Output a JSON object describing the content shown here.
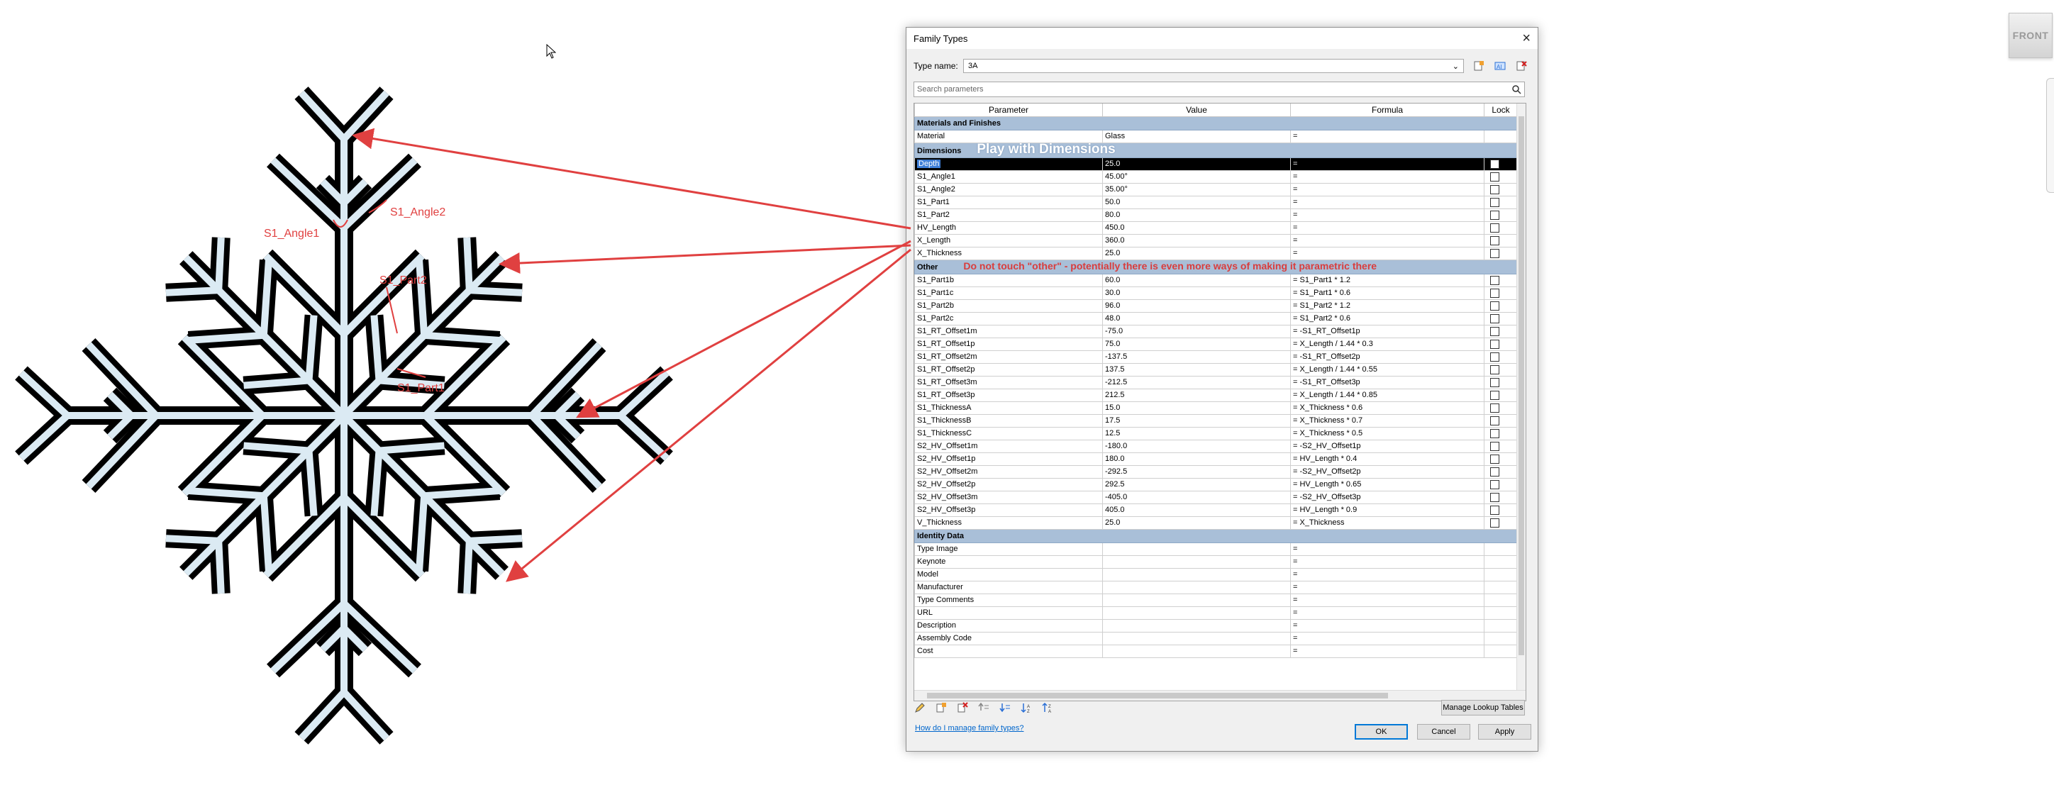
{
  "dialog": {
    "title": "Family Types",
    "type_name_label": "Type name:",
    "type_name_value": "3A",
    "search_placeholder": "Search parameters",
    "columns": [
      "Parameter",
      "Value",
      "Formula",
      "Lock"
    ],
    "groups": [
      {
        "name": "Materials and Finishes",
        "note": "",
        "rows": [
          {
            "param": "Material",
            "value": "Glass",
            "formula": "=",
            "lock": false
          }
        ]
      },
      {
        "name": "Dimensions",
        "note": "Play with Dimensions",
        "rows": [
          {
            "param": "Depth",
            "value": "25.0",
            "formula": "=",
            "lock": true,
            "selected": true
          },
          {
            "param": "S1_Angle1",
            "value": "45.00°",
            "formula": "=",
            "lock": true
          },
          {
            "param": "S1_Angle2",
            "value": "35.00°",
            "formula": "=",
            "lock": true
          },
          {
            "param": "S1_Part1",
            "value": "50.0",
            "formula": "=",
            "lock": true
          },
          {
            "param": "S1_Part2",
            "value": "80.0",
            "formula": "=",
            "lock": true
          },
          {
            "param": "HV_Length",
            "value": "450.0",
            "formula": "=",
            "lock": true
          },
          {
            "param": "X_Length",
            "value": "360.0",
            "formula": "=",
            "lock": true
          },
          {
            "param": "X_Thickness",
            "value": "25.0",
            "formula": "=",
            "lock": true
          }
        ]
      },
      {
        "name": "Other",
        "note": "Do not touch \"other\" - potentially there is even more ways of making it parametric there",
        "rows": [
          {
            "param": "S1_Part1b",
            "value": "60.0",
            "formula": "= S1_Part1 * 1.2",
            "lock": true
          },
          {
            "param": "S1_Part1c",
            "value": "30.0",
            "formula": "= S1_Part1 * 0.6",
            "lock": true
          },
          {
            "param": "S1_Part2b",
            "value": "96.0",
            "formula": "= S1_Part2 * 1.2",
            "lock": true
          },
          {
            "param": "S1_Part2c",
            "value": "48.0",
            "formula": "= S1_Part2 * 0.6",
            "lock": true
          },
          {
            "param": "S1_RT_Offset1m",
            "value": "-75.0",
            "formula": "= -S1_RT_Offset1p",
            "lock": true
          },
          {
            "param": "S1_RT_Offset1p",
            "value": "75.0",
            "formula": "= X_Length / 1.44 * 0.3",
            "lock": true
          },
          {
            "param": "S1_RT_Offset2m",
            "value": "-137.5",
            "formula": "= -S1_RT_Offset2p",
            "lock": true
          },
          {
            "param": "S1_RT_Offset2p",
            "value": "137.5",
            "formula": "= X_Length / 1.44 * 0.55",
            "lock": true
          },
          {
            "param": "S1_RT_Offset3m",
            "value": "-212.5",
            "formula": "= -S1_RT_Offset3p",
            "lock": true
          },
          {
            "param": "S1_RT_Offset3p",
            "value": "212.5",
            "formula": "= X_Length / 1.44 * 0.85",
            "lock": true
          },
          {
            "param": "S1_ThicknessA",
            "value": "15.0",
            "formula": "= X_Thickness * 0.6",
            "lock": true
          },
          {
            "param": "S1_ThicknessB",
            "value": "17.5",
            "formula": "= X_Thickness * 0.7",
            "lock": true
          },
          {
            "param": "S1_ThicknessC",
            "value": "12.5",
            "formula": "= X_Thickness * 0.5",
            "lock": true
          },
          {
            "param": "S2_HV_Offset1m",
            "value": "-180.0",
            "formula": "= -S2_HV_Offset1p",
            "lock": true
          },
          {
            "param": "S2_HV_Offset1p",
            "value": "180.0",
            "formula": "= HV_Length * 0.4",
            "lock": true
          },
          {
            "param": "S2_HV_Offset2m",
            "value": "-292.5",
            "formula": "= -S2_HV_Offset2p",
            "lock": true
          },
          {
            "param": "S2_HV_Offset2p",
            "value": "292.5",
            "formula": "= HV_Length * 0.65",
            "lock": true
          },
          {
            "param": "S2_HV_Offset3m",
            "value": "-405.0",
            "formula": "= -S2_HV_Offset3p",
            "lock": true
          },
          {
            "param": "S2_HV_Offset3p",
            "value": "405.0",
            "formula": "= HV_Length * 0.9",
            "lock": true
          },
          {
            "param": "V_Thickness",
            "value": "25.0",
            "formula": "= X_Thickness",
            "lock": true
          }
        ]
      },
      {
        "name": "Identity Data",
        "note": "",
        "rows": [
          {
            "param": "Type Image",
            "value": "",
            "formula": "=",
            "lock": false
          },
          {
            "param": "Keynote",
            "value": "",
            "formula": "=",
            "lock": false
          },
          {
            "param": "Model",
            "value": "",
            "formula": "=",
            "lock": false
          },
          {
            "param": "Manufacturer",
            "value": "",
            "formula": "=",
            "lock": false
          },
          {
            "param": "Type Comments",
            "value": "",
            "formula": "=",
            "lock": false
          },
          {
            "param": "URL",
            "value": "",
            "formula": "=",
            "lock": false
          },
          {
            "param": "Description",
            "value": "",
            "formula": "=",
            "lock": false
          },
          {
            "param": "Assembly Code",
            "value": "",
            "formula": "=",
            "lock": false
          },
          {
            "param": "Cost",
            "value": "",
            "formula": "=",
            "lock": false
          }
        ]
      }
    ],
    "manage_lookup_label": "Manage Lookup Tables",
    "help_link": "How do I manage family types?",
    "ok_label": "OK",
    "cancel_label": "Cancel",
    "apply_label": "Apply"
  },
  "canvas": {
    "labels": {
      "angle1": "S1_Angle1",
      "angle2": "S1_Angle2",
      "part2": "S1_Part2",
      "part1": "S1_Part1"
    },
    "arrow_color": "#e04040"
  },
  "view_cube": {
    "label": "FRONT"
  }
}
